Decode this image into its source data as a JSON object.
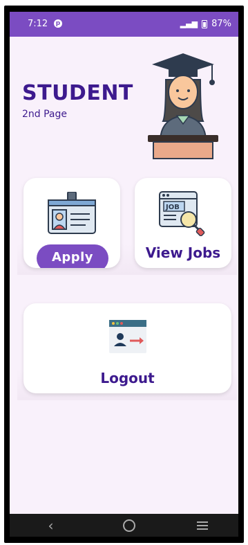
{
  "status_bar": {
    "time": "7:12",
    "notification_icon": "pinterest-icon",
    "battery_percent": "87%",
    "color": "#7b4cc2"
  },
  "header": {
    "title": "STUDENT",
    "subtitle": "2nd Page",
    "illustration": "graduate-student-illustration"
  },
  "cards": {
    "apply": {
      "label": "Apply",
      "icon": "id-card-icon"
    },
    "view_jobs": {
      "label": "View Jobs",
      "icon": "job-search-icon"
    },
    "logout": {
      "label": "Logout",
      "icon": "logout-icon"
    }
  },
  "nav": {
    "back_icon": "back-icon",
    "home_icon": "home-icon",
    "menu_icon": "recents-icon"
  },
  "colors": {
    "accent": "#7b4cc2",
    "title": "#3d1a8e",
    "background": "#f9f1fb"
  }
}
